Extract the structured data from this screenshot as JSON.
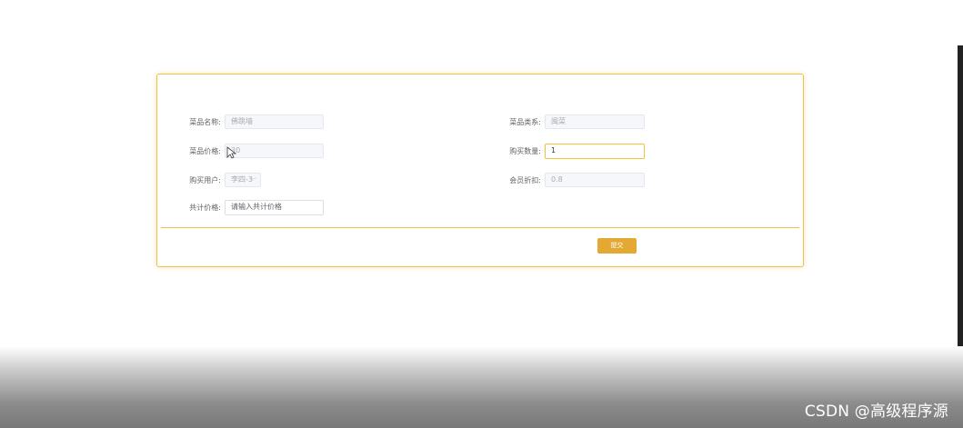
{
  "form": {
    "dish_name": {
      "label": "菜品名称:",
      "value": "佛跳墙"
    },
    "dish_category": {
      "label": "菜品类系:",
      "value": "闽菜"
    },
    "dish_price": {
      "label": "菜品价格:",
      "value": "30"
    },
    "quantity": {
      "label": "购买数量:",
      "value": "1"
    },
    "buyer": {
      "label": "购买用户:",
      "value": "李四-3"
    },
    "member_discount": {
      "label": "会员折扣:",
      "value": "0.8"
    },
    "total_price": {
      "label": "共计价格:",
      "placeholder": "请输入共计价格"
    },
    "submit_label": "提交"
  },
  "watermark": "CSDN @高级程序源"
}
